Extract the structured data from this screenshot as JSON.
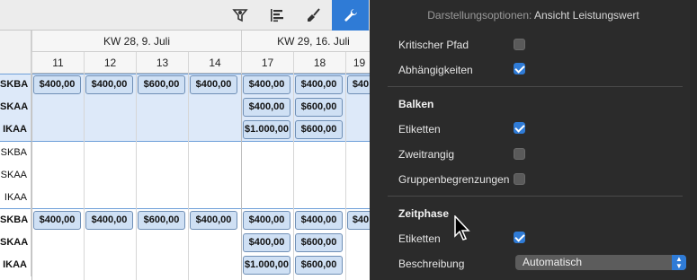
{
  "toolbar": {
    "buttons": [
      {
        "icon": "filter-icon"
      },
      {
        "icon": "gantt-icon"
      },
      {
        "icon": "brush-icon"
      },
      {
        "icon": "wrench-icon",
        "active": true
      }
    ]
  },
  "timeline": {
    "weeks": [
      "KW 28, 9. Juli",
      "KW 29, 16. Juli"
    ],
    "days": [
      "11",
      "12",
      "13",
      "14",
      "17",
      "18",
      "19"
    ]
  },
  "rows": [
    {
      "label": "SKBA",
      "bold": true,
      "values": [
        "$400,00",
        "$400,00",
        "$600,00",
        "$400,00",
        "$400,00",
        "$400,00",
        "$40"
      ]
    },
    {
      "label": "SKAA",
      "bold": true,
      "values": [
        "",
        "",
        "",
        "",
        "$400,00",
        "$600,00",
        ""
      ]
    },
    {
      "label": "IKAA",
      "bold": true,
      "values": [
        "",
        "",
        "",
        "",
        "$1.000,00",
        "$600,00",
        ""
      ]
    },
    {
      "label": "SKBA",
      "bold": false,
      "values": [
        "",
        "",
        "",
        "",
        "",
        "",
        ""
      ]
    },
    {
      "label": "SKAA",
      "bold": false,
      "values": [
        "",
        "",
        "",
        "",
        "",
        "",
        ""
      ]
    },
    {
      "label": "IKAA",
      "bold": false,
      "values": [
        "",
        "",
        "",
        "",
        "",
        "",
        ""
      ]
    },
    {
      "label": "SKBA",
      "bold": true,
      "values": [
        "$400,00",
        "$400,00",
        "$600,00",
        "$400,00",
        "$400,00",
        "$400,00",
        "$40"
      ]
    },
    {
      "label": "SKAA",
      "bold": true,
      "values": [
        "",
        "",
        "",
        "",
        "$400,00",
        "$600,00",
        ""
      ]
    },
    {
      "label": "IKAA",
      "bold": true,
      "values": [
        "",
        "",
        "",
        "",
        "$1.000,00",
        "$600,00",
        ""
      ]
    }
  ],
  "panel": {
    "title_prefix": "Darstellungsoptionen:",
    "title_value": "Ansicht Leistungswert",
    "options_top": [
      {
        "label": "Kritischer Pfad",
        "checked": false
      },
      {
        "label": "Abhängigkeiten",
        "checked": true
      }
    ],
    "bars_heading": "Balken",
    "bars_options": [
      {
        "label": "Etiketten",
        "checked": true
      },
      {
        "label": "Zweitrangig",
        "checked": false
      },
      {
        "label": "Gruppenbegrenzungen",
        "checked": false
      }
    ],
    "timephase_heading": "Zeitphase",
    "timephase_options": [
      {
        "label": "Etiketten",
        "checked": true
      }
    ],
    "description_label": "Beschreibung",
    "description_value": "Automatisch"
  },
  "colors": {
    "accent": "#2f7bd6",
    "panel_bg": "#2b2b2b",
    "cell_fill": "#cfe0f4",
    "selection_fill": "#dde9f9"
  }
}
